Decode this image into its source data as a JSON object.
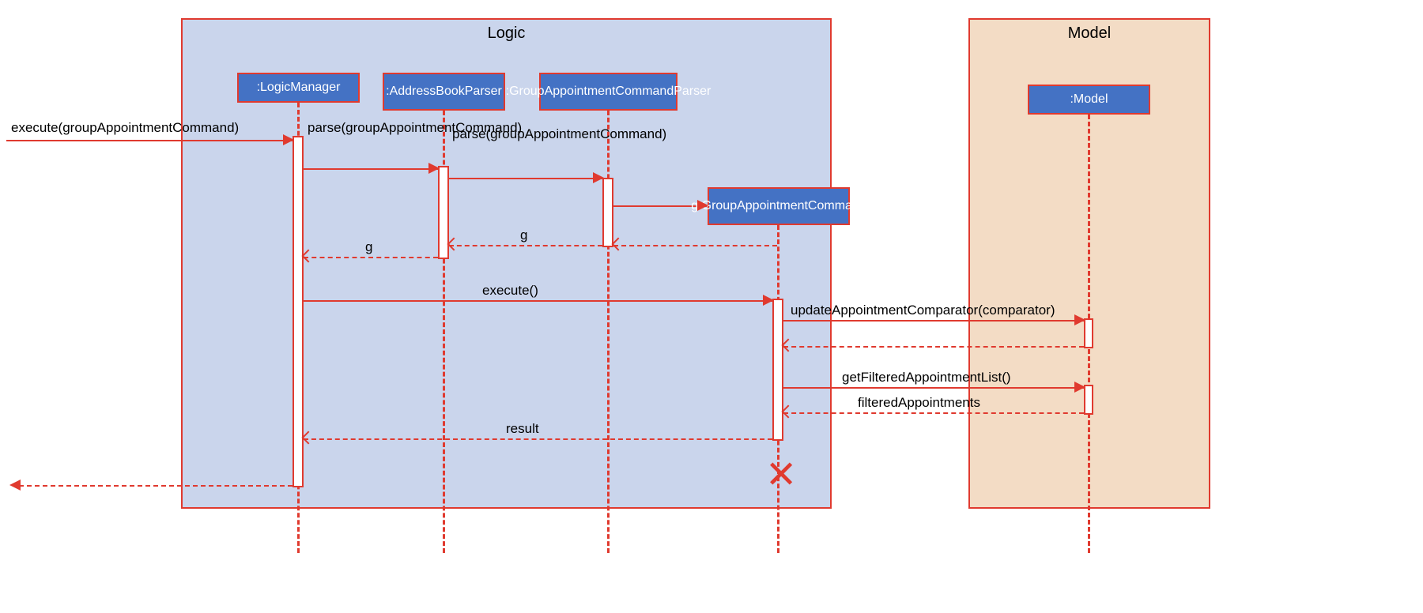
{
  "frames": {
    "logic": "Logic",
    "model": "Model"
  },
  "lifelines": {
    "logicManager": ":LogicManager",
    "addressBookParser": ":AddressBookParser",
    "groupAppointmentCommandParser": ":GroupAppointmentCommandParser",
    "groupAppointmentCommand": "g:GroupAppointmentCommand",
    "model": ":Model"
  },
  "messages": {
    "executeIn": "execute(groupAppointmentCommand)",
    "parse1": "parse(groupAppointmentCommand)",
    "parse2": "parse(groupAppointmentCommand)",
    "returnG1": "g",
    "returnG2": "g",
    "execute": "execute()",
    "updateComparator": "updateAppointmentComparator(comparator)",
    "getFiltered": "getFilteredAppointmentList()",
    "filteredAppts": "filteredAppointments",
    "result": "result"
  }
}
